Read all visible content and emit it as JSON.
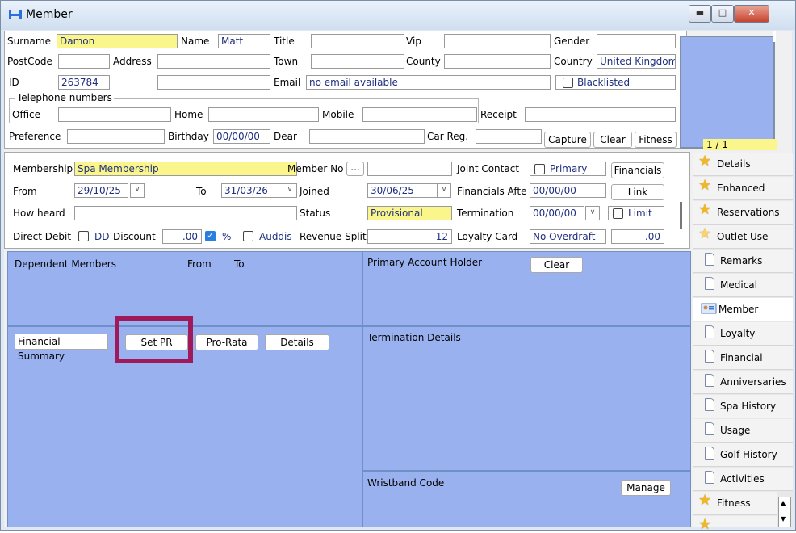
{
  "window": {
    "title": "Member"
  },
  "top": {
    "surname_label": "Surname",
    "surname": "Damon",
    "name_label": "Name",
    "name": "Matt",
    "title_label": "Title",
    "title": "",
    "vip_label": "Vip",
    "vip": "",
    "gender_label": "Gender",
    "gender": "",
    "postcode_label": "PostCode",
    "postcode": "",
    "address_label": "Address",
    "address1": "",
    "address2": "",
    "town_label": "Town",
    "town": "",
    "county_label": "County",
    "county": "",
    "country_label": "Country",
    "country": "United Kingdom",
    "id_label": "ID",
    "id": "263784",
    "email_label": "Email",
    "email": "no email available",
    "blacklisted_label": "Blacklisted",
    "telephone_label": "Telephone numbers",
    "office_label": "Office",
    "office": "",
    "home_label": "Home",
    "home": "",
    "mobile_label": "Mobile",
    "mobile": "",
    "receipt_label": "Receipt",
    "receipt": "",
    "preference_label": "Preference",
    "preference": "",
    "birthday_label": "Birthday",
    "birthday": "00/00/00",
    "dear_label": "Dear",
    "dear": "",
    "carreg_label": "Car Reg.",
    "carreg": "",
    "capture_label": "Capture",
    "clear_label": "Clear",
    "fitness_label": "Fitness",
    "photo_counter": "1 / 1"
  },
  "membership": {
    "membership_label": "Membership",
    "membership": "Spa Membership",
    "member_no_label": "Member No",
    "member_no": "",
    "ellipsis": "...",
    "joint_contact_label": "Joint Contact",
    "primary_label": "Primary",
    "financials_label": "Financials",
    "from_label": "From",
    "from": "29/10/25",
    "to_label": "To",
    "to": "31/03/26",
    "joined_label": "Joined",
    "joined": "30/06/25",
    "financials_after_label": "Financials Afte",
    "financials_after": "00/00/00",
    "link_label": "Link",
    "how_heard_label": "How heard",
    "how_heard": "",
    "status_label": "Status",
    "status": "Provisional",
    "termination_label": "Termination",
    "termination": "00/00/00",
    "limit_label": "Limit",
    "direct_debit_label": "Direct Debit",
    "dd_label": "DD",
    "discount_label": "Discount",
    "discount": ".00",
    "percent_label": "%",
    "auddis_label": "Auddis",
    "revenue_split_label": "Revenue Split",
    "revenue_split": "12",
    "loyalty_card_label": "Loyalty Card",
    "loyalty_card": "No Overdraft",
    "loyalty_value": ".00"
  },
  "panels": {
    "dependent_members": "Dependent Members",
    "dep_from": "From",
    "dep_to": "To",
    "primary_account_holder": "Primary Account Holder",
    "pah_clear": "Clear",
    "financial_summary": "Financial Summary",
    "set_pr": "Set PR",
    "pro_rata": "Pro-Rata",
    "details": "Details",
    "termination_details": "Termination Details",
    "wristband_code": "Wristband Code",
    "manage": "Manage"
  },
  "highlight_color": "#a0195a",
  "tabs": [
    {
      "label": "Details",
      "icon": "star-icon"
    },
    {
      "label": "Enhanced",
      "icon": "star-icon"
    },
    {
      "label": "Reservations",
      "icon": "star-icon"
    },
    {
      "label": "Outlet Use",
      "icon": "star-outline-icon"
    },
    {
      "label": "Remarks",
      "icon": "page-icon"
    },
    {
      "label": "Medical",
      "icon": "page-icon"
    },
    {
      "label": "Member",
      "icon": "member-card-icon"
    },
    {
      "label": "Loyalty",
      "icon": "page-icon"
    },
    {
      "label": "Financial",
      "icon": "page-icon"
    },
    {
      "label": "Anniversaries",
      "icon": "page-icon"
    },
    {
      "label": "Spa History",
      "icon": "page-icon"
    },
    {
      "label": "Usage",
      "icon": "page-icon"
    },
    {
      "label": "Golf History",
      "icon": "page-icon"
    },
    {
      "label": "Activities",
      "icon": "page-icon"
    },
    {
      "label": "Fitness",
      "icon": "star-icon"
    }
  ]
}
